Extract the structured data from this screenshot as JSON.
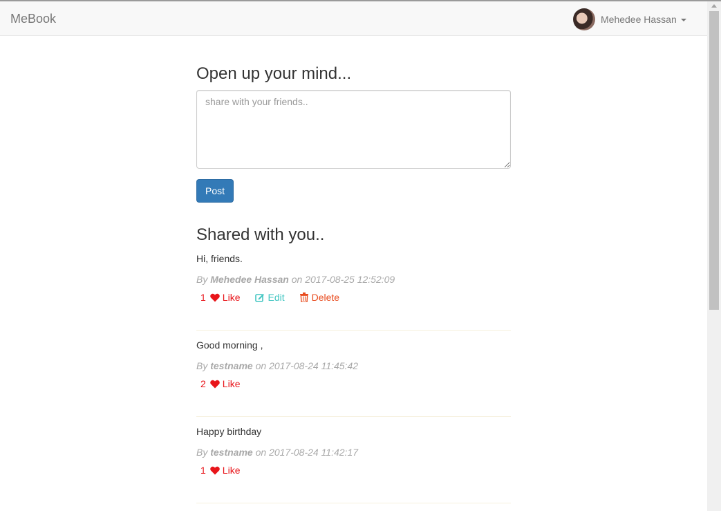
{
  "navbar": {
    "brand": "MeBook",
    "user_name": "Mehedee Hassan"
  },
  "compose": {
    "title": "Open up your mind...",
    "placeholder": "share with your friends..",
    "post_button": "Post"
  },
  "feed": {
    "title": "Shared with you..",
    "posts": [
      {
        "text": "Hi, friends.",
        "by_prefix": "By",
        "author": "Mehedee Hassan",
        "on_prefix": "on",
        "timestamp": "2017-08-25 12:52:09",
        "likes": "1",
        "like_label": "Like",
        "edit_label": "Edit",
        "delete_label": "Delete"
      },
      {
        "text": "Good morning ,",
        "by_prefix": "By",
        "author": "testname",
        "on_prefix": "on",
        "timestamp": "2017-08-24 11:45:42",
        "likes": "2",
        "like_label": "Like"
      },
      {
        "text": "Happy birthday",
        "by_prefix": "By",
        "author": "testname",
        "on_prefix": "on",
        "timestamp": "2017-08-24 11:42:17",
        "likes": "1",
        "like_label": "Like"
      }
    ]
  },
  "colors": {
    "primary": "#337ab7",
    "like": "#e8151a",
    "edit": "#43c6c2",
    "delete": "#e84b1e",
    "meta": "#a8a8a8"
  },
  "icons": {
    "like": "heart-icon",
    "edit": "edit-icon",
    "delete": "trash-icon"
  }
}
